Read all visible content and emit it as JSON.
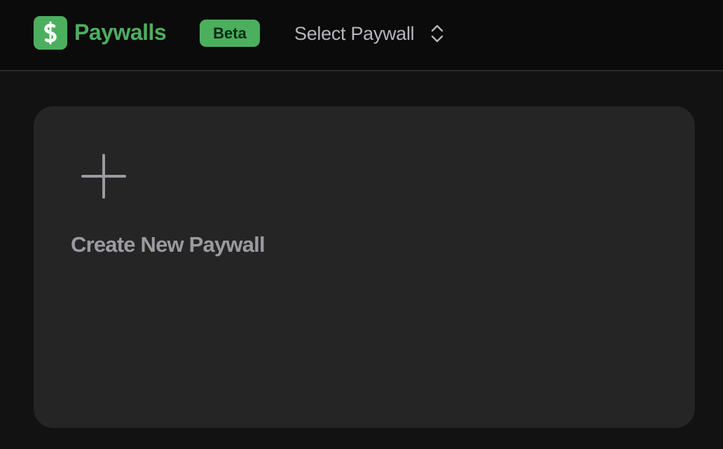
{
  "header": {
    "app_name": "Paywalls",
    "badge": "Beta",
    "selector_label": "Select Paywall",
    "logo_icon": "dollar-sign-icon",
    "selector_icon": "chevron-up-down-icon"
  },
  "main": {
    "create_card": {
      "label": "Create New Paywall",
      "icon": "plus-icon"
    }
  },
  "colors": {
    "accent": "#4caf5e",
    "background": "#121212",
    "header_background": "#0b0b0b",
    "card_background": "#252525",
    "muted_text": "#9a9aa0"
  }
}
